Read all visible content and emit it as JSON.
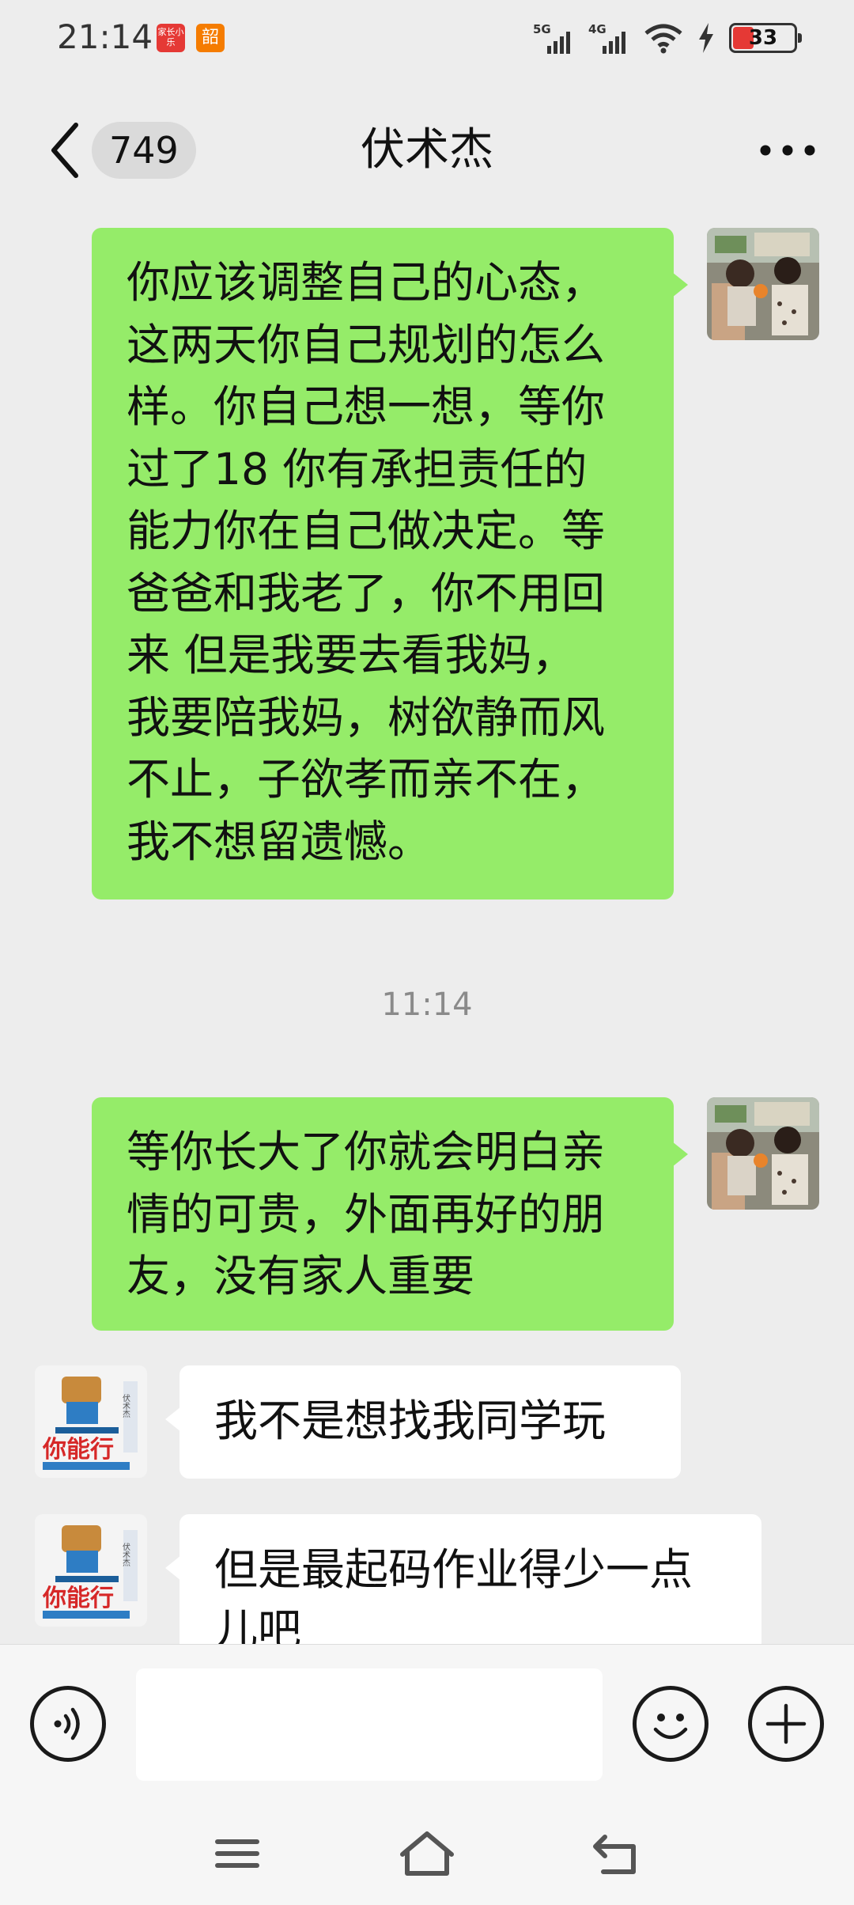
{
  "status_bar": {
    "time": "21:14",
    "badge_1": "家长小乐",
    "badge_2": "韶",
    "signal_1": "5G",
    "signal_2": "4G",
    "battery": "33",
    "battery_level": 0.33
  },
  "nav": {
    "unread_count": "749",
    "title": "伏术杰",
    "more_icon": "more-dots-icon",
    "back_icon": "chevron-left-icon"
  },
  "messages": [
    {
      "direction": "sent",
      "text": "你应该调整自己的心态，\n这两天你自己规划的怎么\n样。你自己想一想，等你\n过了18 你有承担责任的\n能力你在自己做决定。等\n爸爸和我老了，你不用回\n来 但是我要去看我妈，\n我要陪我妈，树欲静而风\n不止，子欲孝而亲不在，\n我不想留遗憾。"
    },
    {
      "type": "timestamp",
      "text": "11:14"
    },
    {
      "direction": "sent",
      "text": "等你长大了你就会明白亲\n情的可贵，外面再好的朋\n友，没有家人重要"
    },
    {
      "direction": "received",
      "text": "我不是想找我同学玩"
    },
    {
      "direction": "received",
      "text": "但是最起码作业得少一点\n儿吧"
    }
  ],
  "contact_avatar_text": {
    "banner": "你能行",
    "side": "伏术杰"
  },
  "input_bar": {
    "placeholder": "",
    "voice_icon": "voice-icon",
    "emoji_icon": "emoji-icon",
    "plus_icon": "plus-icon"
  },
  "system_nav": {
    "menu_icon": "menu-icon",
    "home_icon": "home-icon",
    "back_icon": "back-icon"
  },
  "colors": {
    "sent_bubble": "#95EC69",
    "received_bubble": "#FFFFFF",
    "background": "#EDEDED",
    "battery_low": "#E53935"
  }
}
